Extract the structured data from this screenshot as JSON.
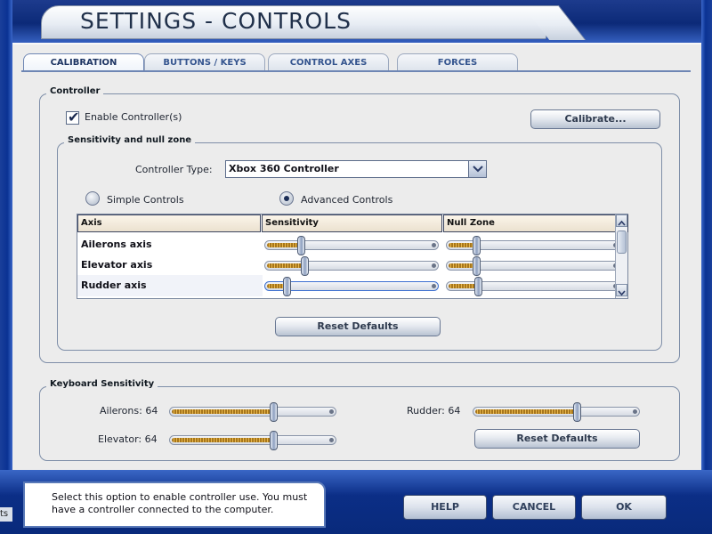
{
  "window": {
    "title": "SETTINGS - CONTROLS"
  },
  "tabs": [
    {
      "label": "CALIBRATION",
      "active": true
    },
    {
      "label": "BUTTONS / KEYS",
      "active": false
    },
    {
      "label": "CONTROL AXES",
      "active": false
    },
    {
      "label": "FORCES",
      "active": false
    }
  ],
  "controller": {
    "group_label": "Controller",
    "enable_label": "Enable Controller(s)",
    "enable_checked": true,
    "calibrate_label": "Calibrate..."
  },
  "sensitivity": {
    "group_label": "Sensitivity and null zone",
    "controller_type_label": "Controller Type:",
    "controller_type_value": "Xbox 360 Controller",
    "simple_label": "Simple Controls",
    "advanced_label": "Advanced Controls",
    "selected_mode": "advanced",
    "columns": [
      "Axis",
      "Sensitivity",
      "Null Zone"
    ],
    "rows": [
      {
        "axis": "Ailerons axis",
        "sensitivity": 0.19,
        "null_zone": 0.15
      },
      {
        "axis": "Elevator axis",
        "sensitivity": 0.21,
        "null_zone": 0.15
      },
      {
        "axis": "Rudder axis",
        "sensitivity": 0.1,
        "null_zone": 0.16
      }
    ],
    "reset_label": "Reset Defaults"
  },
  "keyboard": {
    "group_label": "Keyboard Sensitivity",
    "ailerons_label": "Ailerons: 64",
    "ailerons_value": 0.64,
    "elevator_label": "Elevator: 64",
    "elevator_value": 0.64,
    "rudder_label": "Rudder: 64",
    "rudder_value": 0.64,
    "reset_label": "Reset Defaults"
  },
  "help_text": "Select this option to enable controller use. You must have a controller connected to the computer.",
  "taskbar_stub": "ts",
  "footer": {
    "help": "HELP",
    "cancel": "CANCEL",
    "ok": "OK"
  }
}
